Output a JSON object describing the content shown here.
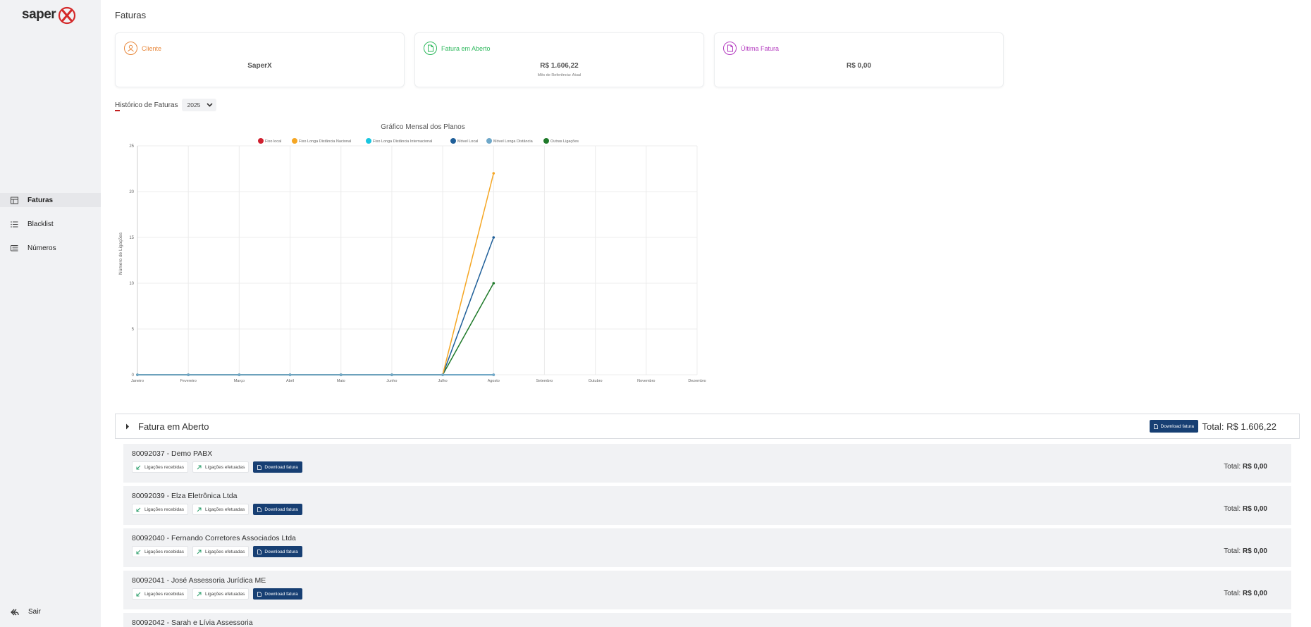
{
  "brand": {
    "logo_text": "saper",
    "accent": "#d42a2a"
  },
  "sidebar": {
    "items": [
      {
        "label": "Faturas",
        "icon": "invoice-table-icon",
        "active": true
      },
      {
        "label": "Blacklist",
        "icon": "list-icon",
        "active": false
      },
      {
        "label": "Números",
        "icon": "numbers-list-icon",
        "active": false
      }
    ],
    "logout_label": "Sair",
    "logout_icon": "reply-arrow-icon"
  },
  "page": {
    "title": "Faturas"
  },
  "cards": {
    "client": {
      "label": "Cliente",
      "value": "SaperX",
      "icon": "user-icon",
      "color": "#e8873a"
    },
    "open": {
      "label": "Fatura em Aberto",
      "value": "R$ 1.606,22",
      "sub": "Mês de Referência: Atual",
      "icon": "document-icon",
      "color": "#2db85c"
    },
    "last": {
      "label": "Última Fatura",
      "value": "R$ 0,00",
      "icon": "document-icon",
      "color": "#b43cc0"
    }
  },
  "history": {
    "label": "Histórico de Faturas",
    "year": "2025"
  },
  "chart_data": {
    "type": "line",
    "title": "Gráfico Mensal dos Planos",
    "ylabel": "Número de Ligações",
    "xlabel": "",
    "ylim": [
      0,
      25
    ],
    "yticks": [
      0,
      5,
      10,
      15,
      20,
      25
    ],
    "legend_position": "top",
    "grid": true,
    "categories": [
      "Janeiro",
      "Fevereiro",
      "Março",
      "Abril",
      "Maio",
      "Junho",
      "Julho",
      "Agosto",
      "Setembro",
      "Outubro",
      "Novembro",
      "Dezembro"
    ],
    "series": [
      {
        "name": "Fixo local",
        "color": "#d0202f",
        "values": [
          0,
          0,
          0,
          0,
          0,
          0,
          0,
          0
        ]
      },
      {
        "name": "Fixo Longa Distância Nacional",
        "color": "#f5a623",
        "values": [
          0,
          0,
          0,
          0,
          0,
          0,
          0,
          22
        ]
      },
      {
        "name": "Fixo Longa Distância Internacional",
        "color": "#19c6e0",
        "values": [
          0,
          0,
          0,
          0,
          0,
          0,
          0,
          0
        ]
      },
      {
        "name": "Móvel Local",
        "color": "#1f5f99",
        "values": [
          0,
          0,
          0,
          0,
          0,
          0,
          0,
          15
        ]
      },
      {
        "name": "Móvel Longa Distância",
        "color": "#6fa8c9",
        "values": [
          0,
          0,
          0,
          0,
          0,
          0,
          0,
          0
        ]
      },
      {
        "name": "Outras Ligações",
        "color": "#1f7a2a",
        "values": [
          0,
          0,
          0,
          0,
          0,
          0,
          0,
          10
        ]
      }
    ]
  },
  "open_invoice": {
    "title": "Fatura em Aberto",
    "download_label": "Download fatura",
    "total_text": "Total: R$ 1.606,22"
  },
  "invoice_rows": [
    {
      "title": "80092037 - Demo PABX",
      "received_label": "Ligações recebidas",
      "made_label": "Ligações efetuadas",
      "download_label": "Download fatura",
      "total_label": "Total:",
      "total_value": "R$ 0,00"
    },
    {
      "title": "80092039 - Elza Eletrônica Ltda",
      "received_label": "Ligações recebidas",
      "made_label": "Ligações efetuadas",
      "download_label": "Download fatura",
      "total_label": "Total:",
      "total_value": "R$ 0,00"
    },
    {
      "title": "80092040 - Fernando Corretores Associados Ltda",
      "received_label": "Ligações recebidas",
      "made_label": "Ligações efetuadas",
      "download_label": "Download fatura",
      "total_label": "Total:",
      "total_value": "R$ 0,00"
    },
    {
      "title": "80092041 - José Assessoria Jurídica ME",
      "received_label": "Ligações recebidas",
      "made_label": "Ligações efetuadas",
      "download_label": "Download fatura",
      "total_label": "Total:",
      "total_value": "R$ 0,00"
    },
    {
      "title": "80092042 - Sarah e Lívia Assessoria"
    }
  ]
}
